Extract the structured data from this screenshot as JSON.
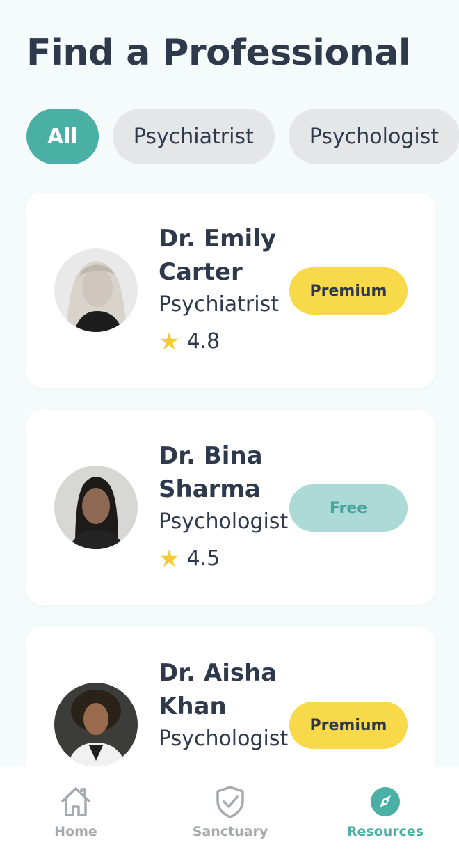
{
  "page": {
    "title": "Find a Professional"
  },
  "filters": [
    {
      "label": "All",
      "active": true
    },
    {
      "label": "Psychiatrist",
      "active": false
    },
    {
      "label": "Psychologist",
      "active": false
    }
  ],
  "professionals": [
    {
      "name": "Dr. Emily Carter",
      "specialty": "Psychiatrist",
      "rating": "4.8",
      "tier": "Premium"
    },
    {
      "name": "Dr. Bina Sharma",
      "specialty": "Psychologist",
      "rating": "4.5",
      "tier": "Free"
    },
    {
      "name": "Dr. Aisha Khan",
      "specialty": "Psychologist",
      "rating": "",
      "tier": "Premium"
    }
  ],
  "nav": {
    "items": [
      {
        "label": "Home",
        "icon": "home-icon",
        "active": false
      },
      {
        "label": "Sanctuary",
        "icon": "shield-check-icon",
        "active": false
      },
      {
        "label": "Resources",
        "icon": "compass-icon",
        "active": true
      }
    ]
  },
  "colors": {
    "accent": "#4aafa5",
    "premium": "#f8d94a",
    "free": "#acdad7",
    "star": "#f3cc34",
    "text": "#2e3a4c"
  }
}
